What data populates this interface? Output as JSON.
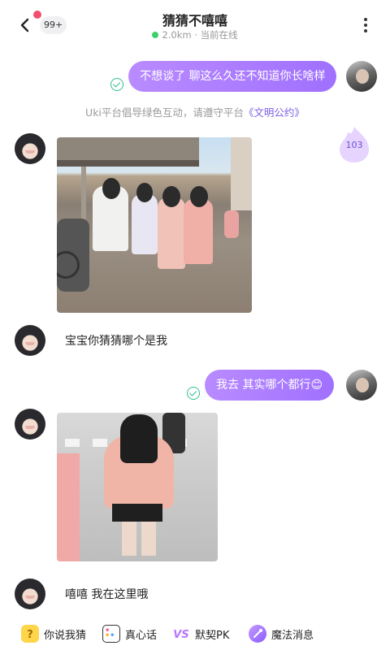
{
  "header": {
    "title": "猜猜不嘻嘻",
    "unread_count": "99+",
    "distance": "2.0km",
    "separator": "·",
    "status": "当前在线"
  },
  "messages": {
    "m1": "不想谈了 聊这么久还不知道你长啥样",
    "m2": "宝宝你猜猜哪个是我",
    "m3": "我去 其实哪个都行😊",
    "m4": "嘻嘻 我在这里哦"
  },
  "notice": {
    "text": "Uki平台倡导绿色互动，请遵守平台",
    "link": "《文明公约》"
  },
  "heat_badge": {
    "value": "103"
  },
  "toolbar": {
    "items": [
      {
        "label": "你说我猜",
        "icon": "question-card-icon"
      },
      {
        "label": "真心话",
        "icon": "dice-icon"
      },
      {
        "label": "默契PK",
        "icon": "versus-icon"
      },
      {
        "label": "魔法消息",
        "icon": "magic-wand-icon"
      }
    ]
  },
  "colors": {
    "bubble_gradient_start": "#b98bff",
    "bubble_gradient_end": "#a070ff",
    "online": "#3ccf6e",
    "link": "#7b5ee8",
    "read_check": "#2fbf8f"
  }
}
